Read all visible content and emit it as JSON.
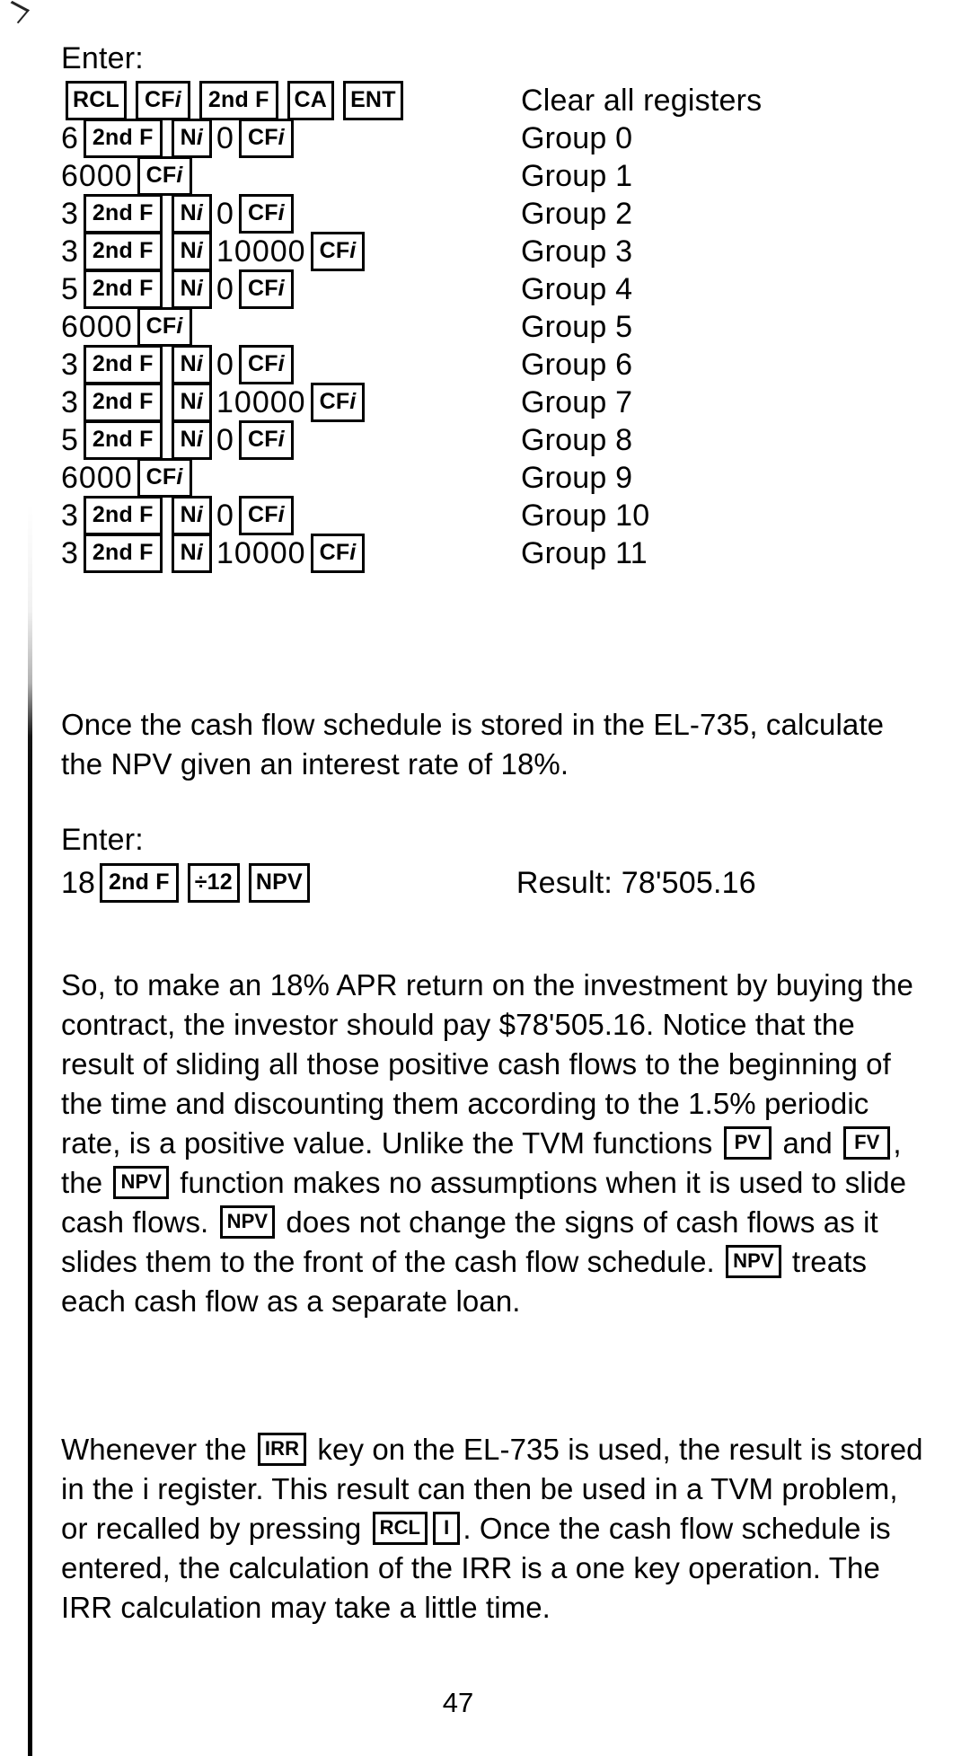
{
  "document": {
    "page_number": "47",
    "device_model": "EL-735"
  },
  "keystroke_table": {
    "enter_label": "Enter:",
    "rows": [
      {
        "tokens": [
          {
            "t": "key",
            "v": "RCL"
          },
          {
            "t": "key",
            "v": "CF",
            "i": "i"
          },
          {
            "t": "key",
            "v": "2nd F"
          },
          {
            "t": "key",
            "v": "CA"
          },
          {
            "t": "key",
            "v": "ENT"
          }
        ],
        "description": "Clear all registers"
      },
      {
        "tokens": [
          {
            "t": "num",
            "v": "6"
          },
          {
            "t": "key",
            "v": "2nd F"
          },
          {
            "t": "key",
            "v": "N",
            "i": "i"
          },
          {
            "t": "num",
            "v": "0"
          },
          {
            "t": "key",
            "v": "CF",
            "i": "i"
          }
        ],
        "description": "Group 0"
      },
      {
        "tokens": [
          {
            "t": "num",
            "v": "6000"
          },
          {
            "t": "key",
            "v": "CF",
            "i": "i"
          }
        ],
        "description": "Group 1"
      },
      {
        "tokens": [
          {
            "t": "num",
            "v": "3"
          },
          {
            "t": "key",
            "v": "2nd F"
          },
          {
            "t": "key",
            "v": "N",
            "i": "i"
          },
          {
            "t": "num",
            "v": "0"
          },
          {
            "t": "key",
            "v": "CF",
            "i": "i"
          }
        ],
        "description": "Group 2"
      },
      {
        "tokens": [
          {
            "t": "num",
            "v": "3"
          },
          {
            "t": "key",
            "v": "2nd F"
          },
          {
            "t": "key",
            "v": "N",
            "i": "i"
          },
          {
            "t": "num",
            "v": "10000"
          },
          {
            "t": "key",
            "v": "CF",
            "i": "i"
          }
        ],
        "description": "Group 3"
      },
      {
        "tokens": [
          {
            "t": "num",
            "v": "5"
          },
          {
            "t": "key",
            "v": "2nd F"
          },
          {
            "t": "key",
            "v": "N",
            "i": "i"
          },
          {
            "t": "num",
            "v": "0"
          },
          {
            "t": "key",
            "v": "CF",
            "i": "i"
          }
        ],
        "description": "Group 4"
      },
      {
        "tokens": [
          {
            "t": "num",
            "v": "6000"
          },
          {
            "t": "key",
            "v": "CF",
            "i": "i"
          }
        ],
        "description": "Group 5"
      },
      {
        "tokens": [
          {
            "t": "num",
            "v": "3"
          },
          {
            "t": "key",
            "v": "2nd F"
          },
          {
            "t": "key",
            "v": "N",
            "i": "i"
          },
          {
            "t": "num",
            "v": "0"
          },
          {
            "t": "key",
            "v": "CF",
            "i": "i"
          }
        ],
        "description": "Group 6"
      },
      {
        "tokens": [
          {
            "t": "num",
            "v": "3"
          },
          {
            "t": "key",
            "v": "2nd F"
          },
          {
            "t": "key",
            "v": "N",
            "i": "i"
          },
          {
            "t": "num",
            "v": "10000"
          },
          {
            "t": "key",
            "v": "CF",
            "i": "i"
          }
        ],
        "description": "Group 7"
      },
      {
        "tokens": [
          {
            "t": "num",
            "v": "5"
          },
          {
            "t": "key",
            "v": "2nd F"
          },
          {
            "t": "key",
            "v": "N",
            "i": "i"
          },
          {
            "t": "num",
            "v": "0"
          },
          {
            "t": "key",
            "v": "CF",
            "i": "i"
          }
        ],
        "description": "Group 8"
      },
      {
        "tokens": [
          {
            "t": "num",
            "v": "6000"
          },
          {
            "t": "key",
            "v": "CF",
            "i": "i"
          }
        ],
        "description": "Group 9"
      },
      {
        "tokens": [
          {
            "t": "num",
            "v": "3"
          },
          {
            "t": "key",
            "v": "2nd F"
          },
          {
            "t": "key",
            "v": "N",
            "i": "i"
          },
          {
            "t": "num",
            "v": "0"
          },
          {
            "t": "key",
            "v": "CF",
            "i": "i"
          }
        ],
        "description": "Group 10"
      },
      {
        "tokens": [
          {
            "t": "num",
            "v": "3"
          },
          {
            "t": "key",
            "v": "2nd F"
          },
          {
            "t": "key",
            "v": "N",
            "i": "i"
          },
          {
            "t": "num",
            "v": "10000"
          },
          {
            "t": "key",
            "v": "CF",
            "i": "i"
          }
        ],
        "description": "Group 11"
      }
    ]
  },
  "paragraph_once": "Once the cash flow schedule is stored in the EL-735, calculate the NPV given an interest rate of 18%.",
  "npv_calculation": {
    "enter_label": "Enter:",
    "tokens": [
      {
        "t": "num",
        "v": "18"
      },
      {
        "t": "key",
        "v": "2nd F"
      },
      {
        "t": "key",
        "v": "÷12"
      },
      {
        "t": "key",
        "v": "NPV"
      }
    ],
    "result_label": "Result: 78'505.16"
  },
  "paragraph_npv": {
    "part1": "So, to make an 18% APR return on the investment by buying the contract, the investor should pay $78'505.16. Notice that the result of sliding all those positive cash flows to the beginning of the time and discounting them according to the 1.5% periodic rate, is a positive value. Unlike the TVM functions ",
    "key_pv": "PV",
    "part2": " and ",
    "key_fv": "FV",
    "part3": ", the ",
    "key_npv1": "NPV",
    "part4": " function makes no assumptions when it is used to slide cash flows. ",
    "key_npv2": "NPV",
    "part5": " does not change the signs of cash flows as it slides them to the front of the cash flow schedule. ",
    "key_npv3": "NPV",
    "part6": " treats each cash flow as a separate loan."
  },
  "paragraph_irr": {
    "part1": "Whenever the ",
    "key_irr": "IRR",
    "part2": " key on the EL-735 is used, the result is stored in the i register. This result can then be used in a TVM problem, or recalled by pressing ",
    "key_rcl": "RCL",
    "key_i": "I",
    "part3": ". Once the cash flow schedule is entered, the calculation of the IRR is a one key operation. The IRR calculation may take a little time."
  }
}
